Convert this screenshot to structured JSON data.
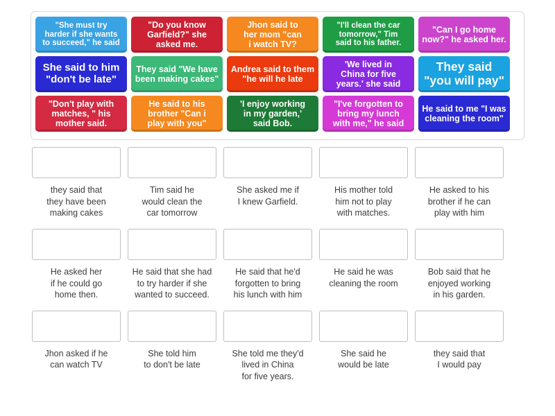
{
  "tiles_panel": {
    "name": "draggable-tiles-panel",
    "rows": [
      [
        {
          "text": "\"She must try\nharder if she wants\nto succeed,\" he said",
          "color": "#3aa3e3",
          "size": "fs-sm"
        },
        {
          "text": "\"Do you know\nGarfield?\" she\nasked me.",
          "color": "#cc2233",
          "size": "fs-md"
        },
        {
          "text": "Jhon said to\nher mom \"can\ni watch TV?",
          "color": "#f5891f",
          "size": "fs-md"
        },
        {
          "text": "\"I'll clean the car\ntomorrow,\" Tim\nsaid to his father.",
          "color": "#1f9d45",
          "size": "fs-sm"
        },
        {
          "text": "\"Can I go home\nnow?\" he asked her.",
          "color": "#cc44cc",
          "size": "fs-md"
        }
      ],
      [
        {
          "text": "She said to him\n\"don't be late\"",
          "color": "#2a2ad4",
          "size": "fs-lg"
        },
        {
          "text": "They said \"We have\nbeen making cakes\"",
          "color": "#3cb878",
          "size": "fs-md"
        },
        {
          "text": "Andrea said to them\n\"he will he late",
          "color": "#ea3a0e",
          "size": "fs-md"
        },
        {
          "text": "'We lived in\nChina for five\nyears.' she said",
          "color": "#8a2be2",
          "size": "fs-md"
        },
        {
          "text": "They said\n\"you will pay\"",
          "color": "#1aa3e0",
          "size": "fs-xl"
        }
      ],
      [
        {
          "text": "\"Don't play with\nmatches, \" his\nmother said.",
          "color": "#d42a42",
          "size": "fs-md"
        },
        {
          "text": "He said to his\nbrother \"Can i\nplay with you\"",
          "color": "#f5891f",
          "size": "fs-md"
        },
        {
          "text": "'I enjoy working\nin my garden,'\nsaid Bob.",
          "color": "#1e7b37",
          "size": "fs-md"
        },
        {
          "text": "\"I've forgotten to\nbring my lunch\nwith me,\" he said",
          "color": "#d63ad6",
          "size": "fs-md"
        },
        {
          "text": "He said to me \"I was\ncleaning the room\"",
          "color": "#2a2ad4",
          "size": "fs-md"
        }
      ]
    ]
  },
  "answer_slots": {
    "name": "answer-slots-grid",
    "rows": [
      [
        {
          "label": "they said that\nthey have been\nmaking cakes"
        },
        {
          "label": "Tim said he\nwould clean the\ncar tomorrow"
        },
        {
          "label": "She asked me if\nI knew Garfield."
        },
        {
          "label": "His mother told\nhim not to play\nwith matches."
        },
        {
          "label": "He asked to his\nbrother if he can\nplay with him"
        }
      ],
      [
        {
          "label": "He asked her\nif he could go\nhome then."
        },
        {
          "label": "He said that she had\nto try harder if she\nwanted to succeed."
        },
        {
          "label": "He said that he'd\nforgotten to bring\nhis lunch with him"
        },
        {
          "label": "He said he was\ncleaning the room"
        },
        {
          "label": "Bob said that he\nenjoyed working\nin his garden."
        }
      ],
      [
        {
          "label": "Jhon asked if he\ncan watch TV"
        },
        {
          "label": "She told him\nto don't be late"
        },
        {
          "label": "She told me they'd\nlived in China\nfor five years."
        },
        {
          "label": "She said he\nwould be late"
        },
        {
          "label": "they said that\nI would pay"
        }
      ]
    ]
  }
}
